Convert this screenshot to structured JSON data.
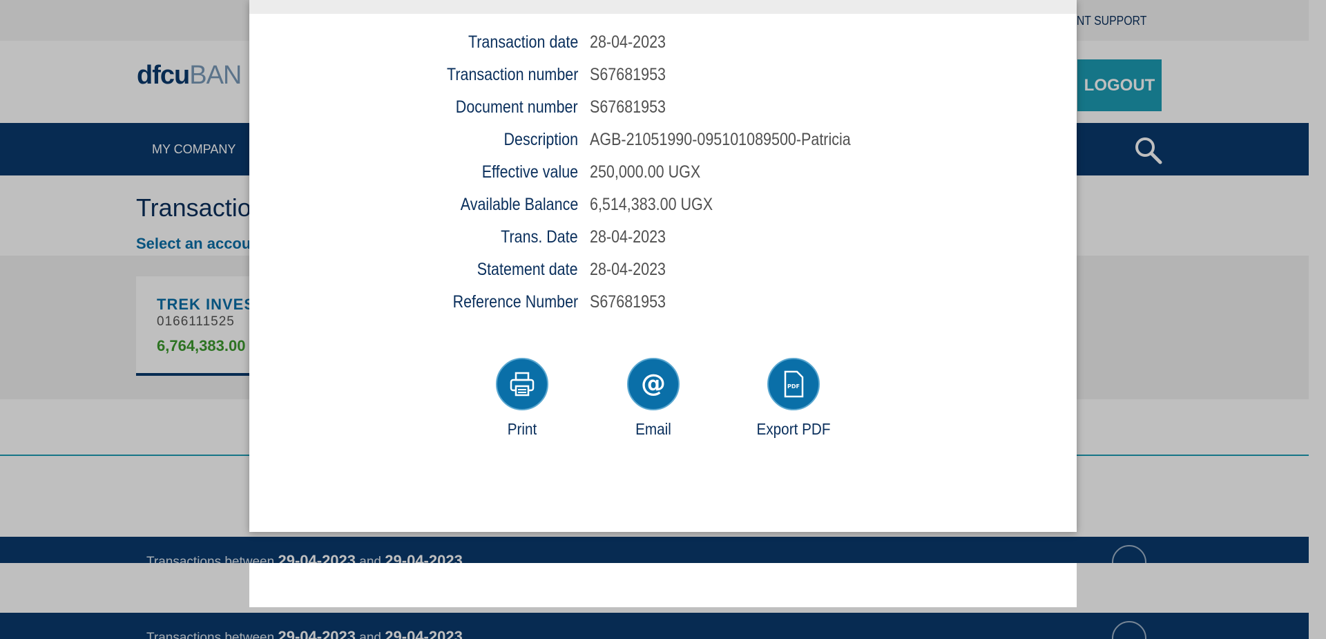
{
  "topbar": {
    "support_link": "LIENT SUPPORT"
  },
  "header": {
    "logo_main": "dfcu",
    "logo_rest": "BAN",
    "logout_label": "LOGOUT"
  },
  "nav": {
    "items": [
      {
        "label": "MY COMPANY"
      }
    ]
  },
  "page": {
    "title": "Transactions",
    "subtitle": "Select an account"
  },
  "account": {
    "name": "TREK INVES",
    "number": "0166111525",
    "balance": "6,764,383.00"
  },
  "periods": [
    {
      "prefix": "Transactions between",
      "from": "29-04-2023",
      "and": "and",
      "to": "29-04-2023"
    },
    {
      "prefix": "Transactions between",
      "from": "29-04-2023",
      "and": "and",
      "to": "29-04-2023"
    }
  ],
  "modal": {
    "details": [
      {
        "label": "Transaction date",
        "value": "28-04-2023"
      },
      {
        "label": "Transaction number",
        "value": "S67681953"
      },
      {
        "label": "Document number",
        "value": "S67681953"
      },
      {
        "label": "Description",
        "value": "AGB-21051990-095101089500-Patricia"
      },
      {
        "label": "Effective value",
        "value": "250,000.00 UGX"
      },
      {
        "label": "Available Balance",
        "value": "6,514,383.00 UGX"
      },
      {
        "label": "Trans. Date",
        "value": "28-04-2023"
      },
      {
        "label": "Statement date",
        "value": "28-04-2023"
      },
      {
        "label": "Reference Number",
        "value": "S67681953"
      }
    ],
    "actions": {
      "print": {
        "label": "Print",
        "icon": "printer-icon"
      },
      "email": {
        "label": "Email",
        "icon": "at-icon"
      },
      "pdf": {
        "label": "Export PDF",
        "icon": "pdf-file-icon",
        "icon_text": "PDF"
      }
    }
  },
  "colors": {
    "brand_navy": "#0a3a6e",
    "accent_teal": "#1d9db4",
    "action_blue": "#0a6fa8",
    "balance_green": "#3c9a2e"
  }
}
